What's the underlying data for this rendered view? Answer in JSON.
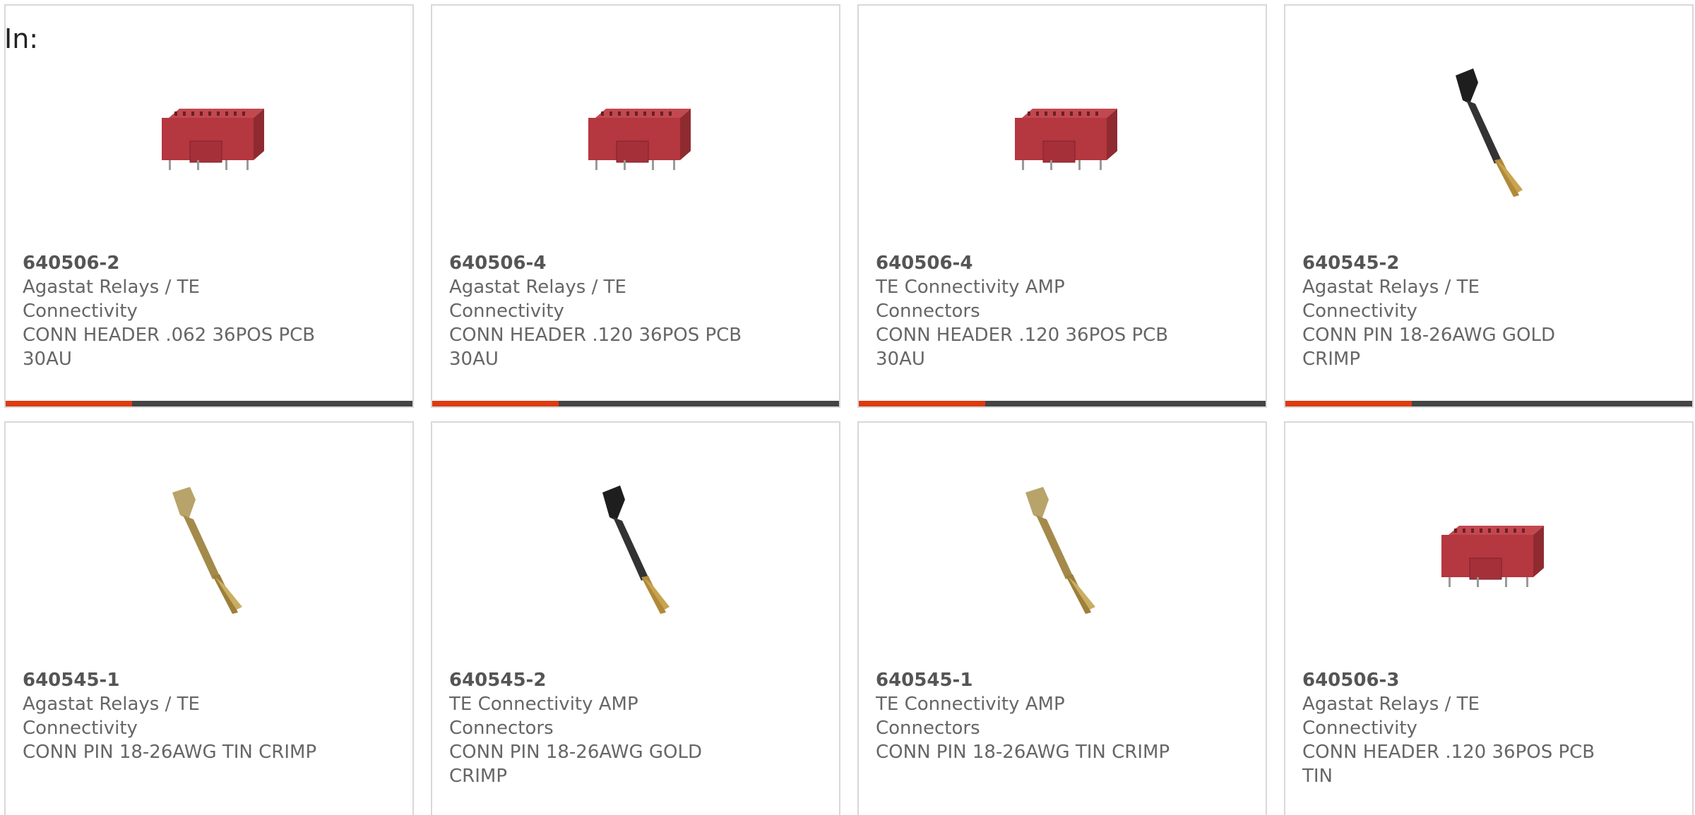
{
  "filter": {
    "label": "In:"
  },
  "colors": {
    "accent": "#dd3a12",
    "bar_track": "#444444",
    "card_border": "#d8d8d8",
    "text": "#666666"
  },
  "products": [
    {
      "part": "640506-2",
      "manufacturer": "Agastat Relays / TE Connectivity",
      "description": "CONN HEADER .062 36POS PCB 30AU",
      "image": "header-connector-image",
      "progress_fraction": 0.31
    },
    {
      "part": "640506-4",
      "manufacturer": "Agastat Relays / TE Connectivity",
      "description": "CONN HEADER .120 36POS PCB 30AU",
      "image": "header-connector-image",
      "progress_fraction": 0.31
    },
    {
      "part": "640506-4",
      "manufacturer": "TE Connectivity AMP Connectors",
      "description": "CONN HEADER .120 36POS PCB 30AU",
      "image": "header-connector-image",
      "progress_fraction": 0.31
    },
    {
      "part": "640545-2",
      "manufacturer": "Agastat Relays / TE Connectivity",
      "description": "CONN PIN 18-26AWG GOLD CRIMP",
      "image": "black-crimp-pin-image",
      "progress_fraction": 0.31
    },
    {
      "part": "640545-1",
      "manufacturer": "Agastat Relays / TE Connectivity",
      "description": "CONN PIN 18-26AWG TIN CRIMP",
      "image": "gold-crimp-pin-image"
    },
    {
      "part": "640545-2",
      "manufacturer": "TE Connectivity AMP Connectors",
      "description": "CONN PIN 18-26AWG GOLD CRIMP",
      "image": "black-crimp-pin-image"
    },
    {
      "part": "640545-1",
      "manufacturer": "TE Connectivity AMP Connectors",
      "description": "CONN PIN 18-26AWG TIN CRIMP",
      "image": "gold-crimp-pin-image"
    },
    {
      "part": "640506-3",
      "manufacturer": "Agastat Relays / TE Connectivity",
      "description": "CONN HEADER .120 36POS PCB TIN",
      "image": "header-connector-image"
    }
  ]
}
